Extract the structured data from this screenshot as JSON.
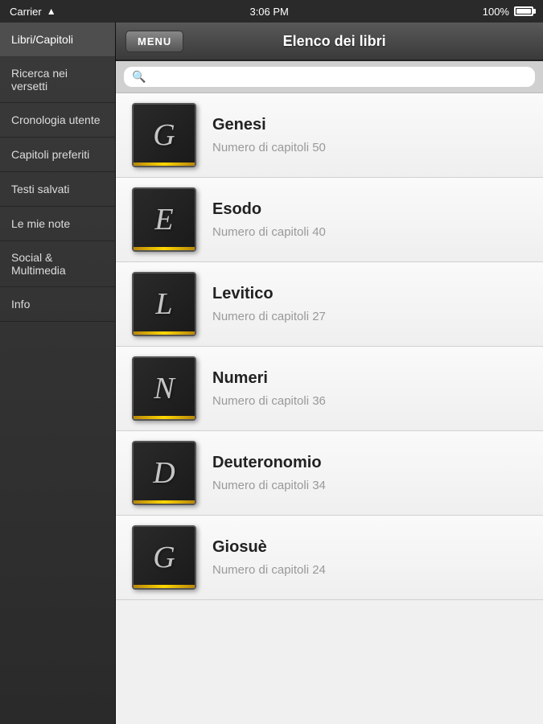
{
  "statusBar": {
    "carrier": "Carrier",
    "time": "3:06 PM",
    "battery": "100%"
  },
  "navBar": {
    "menuLabel": "MENU",
    "title": "Elenco dei libri"
  },
  "search": {
    "placeholder": ""
  },
  "sidebar": {
    "items": [
      {
        "id": "libri-capitoli",
        "label": "Libri/Capitoli",
        "active": true
      },
      {
        "id": "ricerca-versetti",
        "label": "Ricerca nei versetti",
        "active": false
      },
      {
        "id": "cronologia-utente",
        "label": "Cronologia utente",
        "active": false
      },
      {
        "id": "capitoli-preferiti",
        "label": "Capitoli preferiti",
        "active": false
      },
      {
        "id": "testi-salvati",
        "label": "Testi salvati",
        "active": false
      },
      {
        "id": "le-mie-note",
        "label": "Le mie note",
        "active": false
      },
      {
        "id": "social-multimedia",
        "label": "Social & Multimedia",
        "active": false
      },
      {
        "id": "info",
        "label": "Info",
        "active": false
      }
    ]
  },
  "books": [
    {
      "id": "genesi",
      "letter": "G",
      "name": "Genesi",
      "chapters_label": "Numero di capitoli 50"
    },
    {
      "id": "esodo",
      "letter": "E",
      "name": "Esodo",
      "chapters_label": "Numero di capitoli 40"
    },
    {
      "id": "levitico",
      "letter": "L",
      "name": "Levitico",
      "chapters_label": "Numero di capitoli 27"
    },
    {
      "id": "numeri",
      "letter": "N",
      "name": "Numeri",
      "chapters_label": "Numero di capitoli 36"
    },
    {
      "id": "deuteronomio",
      "letter": "D",
      "name": "Deuteronomio",
      "chapters_label": "Numero di capitoli 34"
    },
    {
      "id": "giosue",
      "letter": "G",
      "name": "Giosuè",
      "chapters_label": "Numero di capitoli 24"
    }
  ]
}
